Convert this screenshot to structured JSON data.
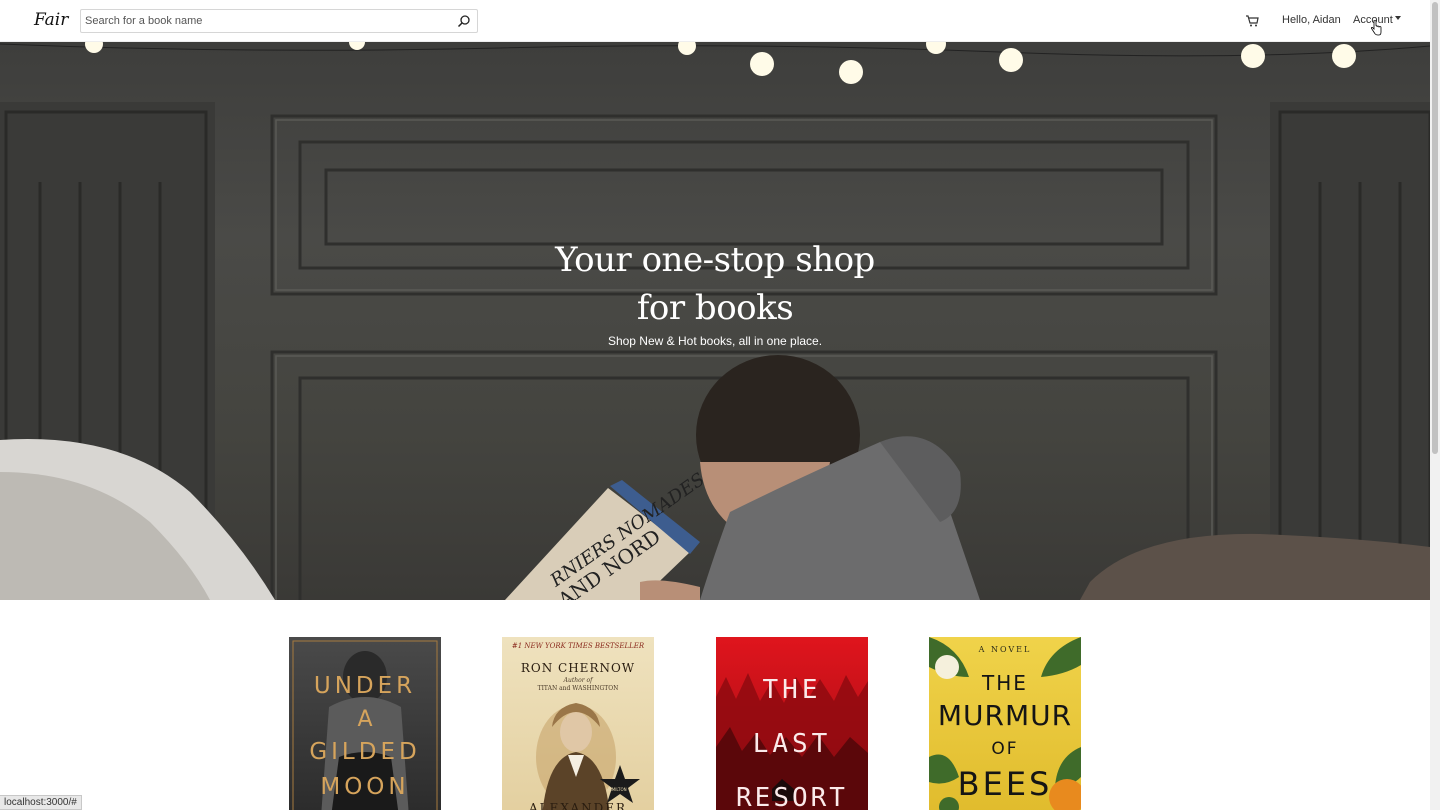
{
  "nav": {
    "logo": "Fair",
    "search_placeholder": "Search for a book name",
    "greeting": "Hello, Aidan",
    "account_label": "Account"
  },
  "hero": {
    "title_line1": "Your one-stop shop",
    "title_line2": "for books",
    "subtitle": "Shop New & Hot books, all in one place."
  },
  "books": [
    {
      "lines": [
        "UNDER",
        "A",
        "GILDED",
        "MOON"
      ]
    },
    {
      "banner": "#1 NEW YORK TIMES BESTSELLER",
      "author": "RON CHERNOW",
      "author_note_1": "Author of",
      "author_note_2": "TITAN and WASHINGTON",
      "bottom": "ALEXANDER",
      "badge": "HAMILTON"
    },
    {
      "lines": [
        "THE",
        "LAST",
        "RESORT"
      ]
    },
    {
      "top": "A NOVEL",
      "lines": [
        "THE",
        "MURMUR",
        "OF",
        "BEES"
      ]
    }
  ],
  "status_url": "localhost:3000/#",
  "colors": {
    "text": "#333333",
    "hero_bg": "#44443f",
    "book3_red": "#d4141b",
    "book4_yellow": "#e9c83a"
  }
}
